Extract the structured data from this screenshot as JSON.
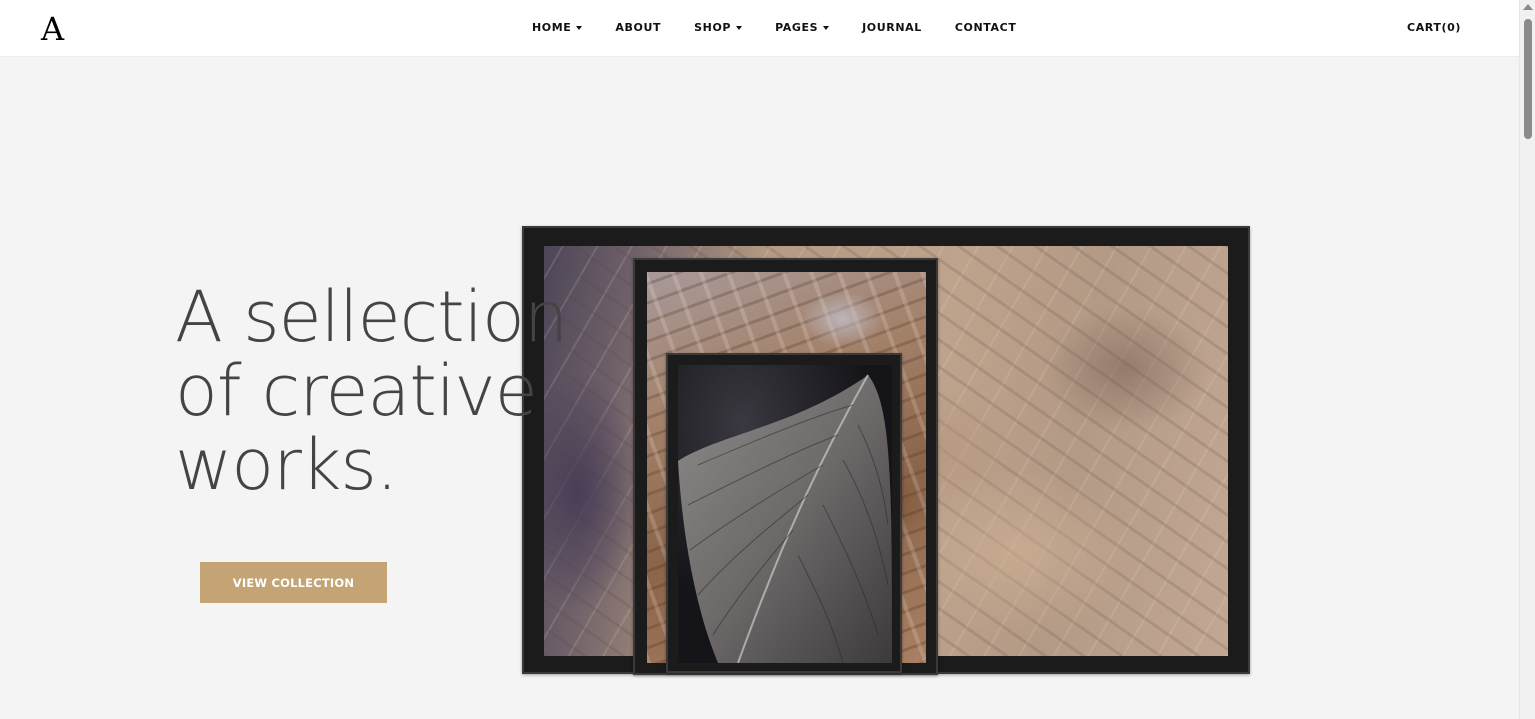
{
  "brand": {
    "logo": "A"
  },
  "nav": {
    "items": [
      {
        "label": "HOME",
        "dropdown": true
      },
      {
        "label": "ABOUT",
        "dropdown": false
      },
      {
        "label": "SHOP",
        "dropdown": true
      },
      {
        "label": "PAGES",
        "dropdown": true
      },
      {
        "label": "JOURNAL",
        "dropdown": false
      },
      {
        "label": "CONTACT",
        "dropdown": false
      }
    ],
    "cart_label": "CART(0)"
  },
  "hero": {
    "headline_lines": [
      "A sellection",
      "of creative",
      "works."
    ],
    "button_label": "VIEW COLLECTION",
    "button_color": "#c4a375"
  },
  "artwork": {
    "frames": [
      {
        "name": "large-frame",
        "subject": "abstract sandstone texture"
      },
      {
        "name": "medium-frame",
        "subject": "dried coral texture"
      },
      {
        "name": "small-frame",
        "subject": "dark leaf close-up"
      }
    ]
  },
  "colors": {
    "background": "#f4f4f4",
    "header": "#ffffff",
    "accent": "#c4a375",
    "text": "#111111"
  }
}
